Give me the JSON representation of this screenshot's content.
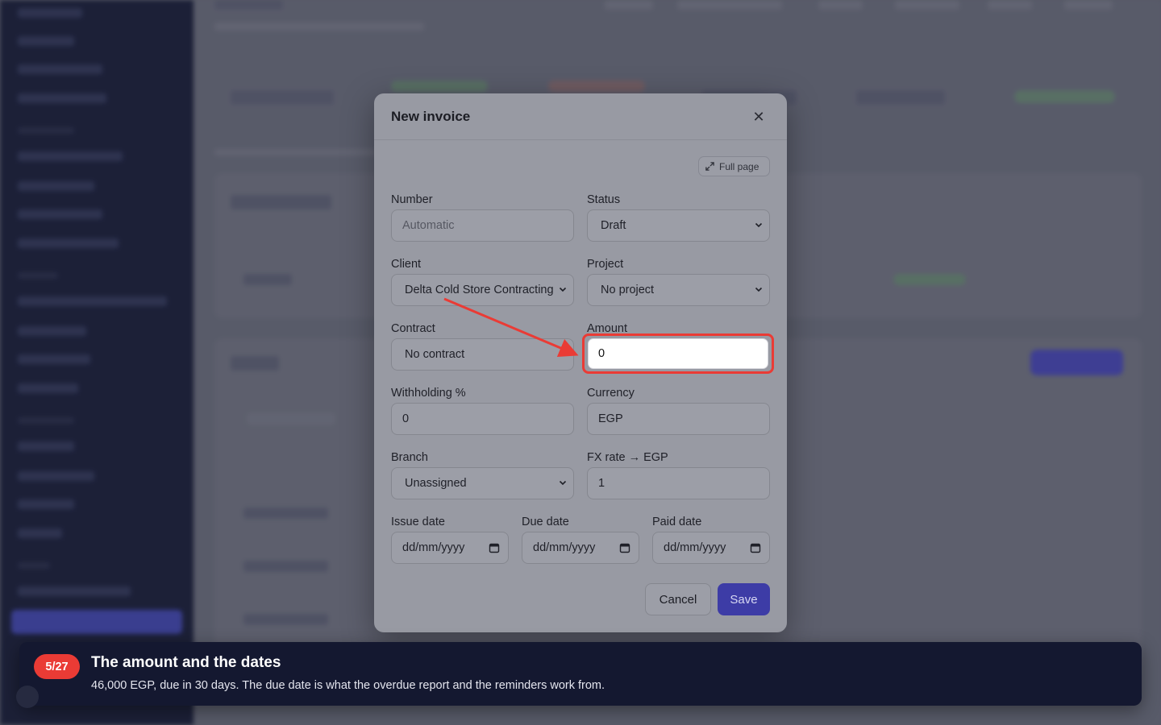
{
  "modal": {
    "title": "New invoice",
    "close_icon": "close-icon",
    "full_page_label": "Full page",
    "fields": {
      "number": {
        "label": "Number",
        "placeholder": "Automatic"
      },
      "status": {
        "label": "Status",
        "value": "Draft"
      },
      "client": {
        "label": "Client",
        "value": "Delta Cold Store Contracting"
      },
      "project": {
        "label": "Project",
        "value": "No project"
      },
      "contract": {
        "label": "Contract",
        "value": "No contract"
      },
      "amount": {
        "label": "Amount",
        "value": "0"
      },
      "withholding": {
        "label": "Withholding %",
        "value": "0"
      },
      "currency": {
        "label": "Currency",
        "value": "EGP"
      },
      "branch": {
        "label": "Branch",
        "value": "Unassigned"
      },
      "fx_rate": {
        "label": "FX rate → EGP",
        "value": "1"
      },
      "issue_date": {
        "label": "Issue date",
        "placeholder": "dd/mm/yyyy"
      },
      "due_date": {
        "label": "Due date",
        "placeholder": "dd/mm/yyyy"
      },
      "paid_date": {
        "label": "Paid date",
        "placeholder": "dd/mm/yyyy"
      }
    },
    "cancel_label": "Cancel",
    "save_label": "Save"
  },
  "tour": {
    "step": "5/27",
    "title": "The amount and the dates",
    "text": "46,000 EGP, due in 30 days. The due date is what the overdue report and the reminders work from."
  },
  "colors": {
    "accent": "#3d3ca6",
    "highlight": "#ea3b35",
    "tour_bg": "#141830"
  }
}
